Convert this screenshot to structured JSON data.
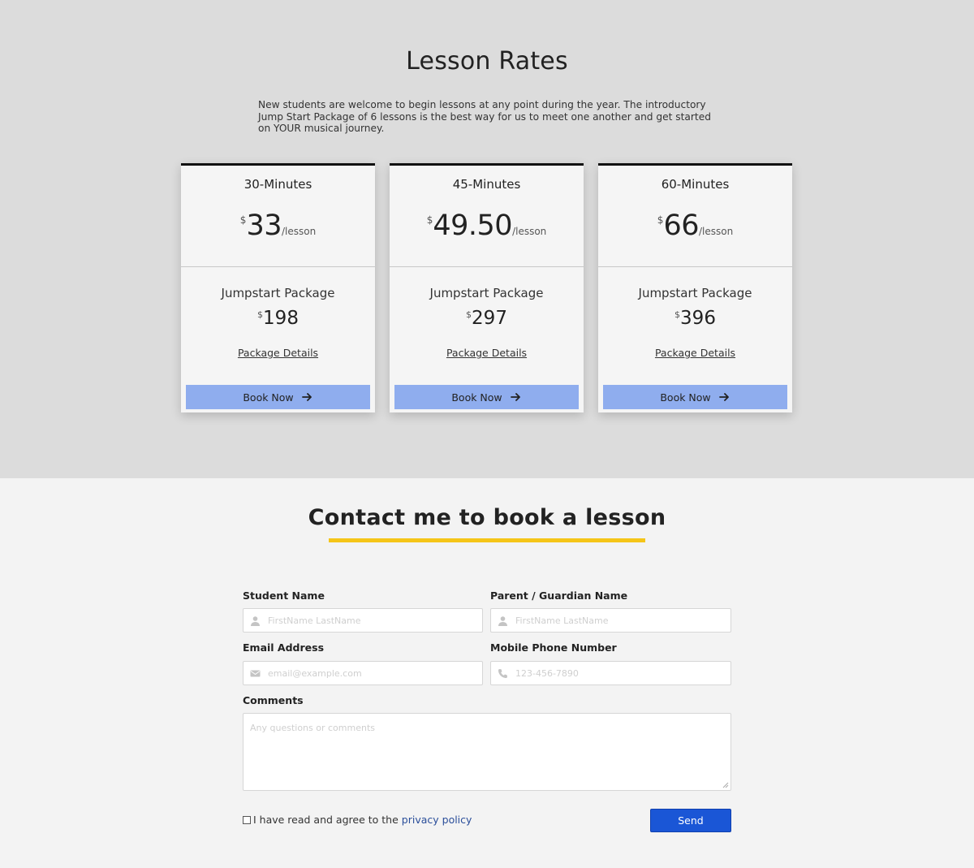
{
  "rates": {
    "title": "Lesson Rates",
    "intro": "New students are welcome to begin lessons at any point during the year. The introductory Jump Start Package of 6 lessons is the best way for us to meet one another and get started on YOUR musical journey.",
    "cards": [
      {
        "duration": "30-Minutes",
        "currency": "$",
        "price": "33",
        "unit": "/lesson",
        "package_name": "Jumpstart Package",
        "package_currency": "$",
        "package_price": "198",
        "details_link": "Package Details",
        "button_label": "Book Now"
      },
      {
        "duration": "45-Minutes",
        "currency": "$",
        "price": "49.50",
        "unit": "/lesson",
        "package_name": "Jumpstart Package",
        "package_currency": "$",
        "package_price": "297",
        "details_link": "Package Details",
        "button_label": "Book Now"
      },
      {
        "duration": "60-Minutes",
        "currency": "$",
        "price": "66",
        "unit": "/lesson",
        "package_name": "Jumpstart Package",
        "package_currency": "$",
        "package_price": "396",
        "details_link": "Package Details",
        "button_label": "Book Now"
      }
    ],
    "button_icon": "arrow-right-icon"
  },
  "contact": {
    "title": "Contact me to book a lesson",
    "accent_color": "#f5c518",
    "student_name": {
      "label": "Student Name",
      "placeholder": "FirstName LastName",
      "value": "",
      "icon": "user-icon"
    },
    "guardian_name": {
      "label": "Parent / Guardian Name",
      "placeholder": "FirstName LastName",
      "value": "",
      "icon": "user-icon"
    },
    "email": {
      "label": "Email Address",
      "placeholder": "email@example.com",
      "value": "",
      "icon": "envelope-icon"
    },
    "phone": {
      "label": "Mobile Phone Number",
      "placeholder": "123-456-7890",
      "value": "",
      "icon": "phone-icon"
    },
    "comments": {
      "label": "Comments",
      "placeholder": "Any questions or comments",
      "value": ""
    },
    "agree_text": "I have read and agree to the",
    "agree_link": "privacy policy",
    "agree_checked": false,
    "send_label": "Send",
    "send_color": "#1a56d6"
  }
}
